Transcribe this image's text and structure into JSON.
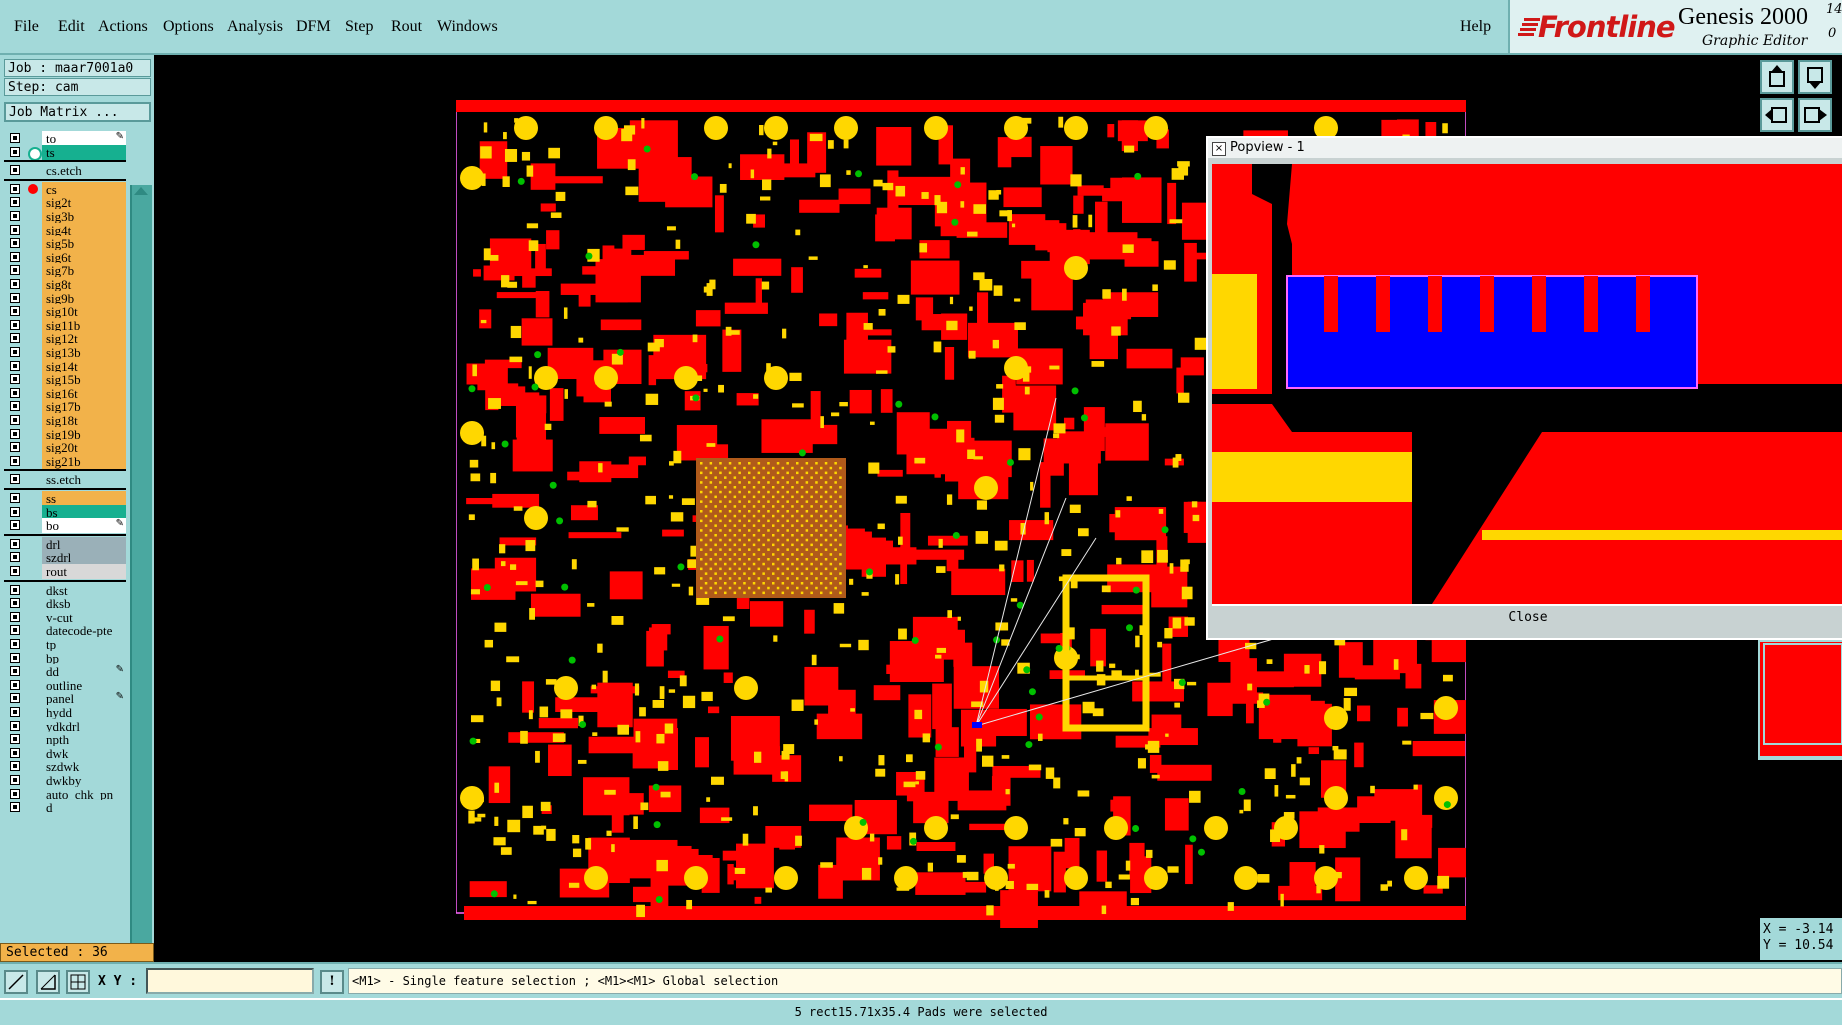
{
  "menu": {
    "items": [
      "File",
      "Edit",
      "Actions",
      "Options",
      "Analysis",
      "DFM",
      "Step",
      "Rout",
      "Windows"
    ],
    "help": "Help"
  },
  "logo": {
    "brand": "Frontline",
    "product": "Genesis 2000",
    "version_top": "14",
    "version_bottom": "0",
    "subtitle": "Graphic Editor"
  },
  "job": {
    "job_label": "Job : maar7001a0",
    "step_label": "Step: cam",
    "matrix_button": "Job Matrix ..."
  },
  "layers": [
    {
      "name": "to",
      "color": "#ffffff",
      "icon": "pencil-icon"
    },
    {
      "name": "ts",
      "color": "#16b090",
      "icon": "marker-icon"
    },
    {
      "name": "cs.etch",
      "color": "#a3d9d9"
    },
    {
      "name": "cs",
      "color": "#f2b24a",
      "active": true
    },
    {
      "name": "sig2t",
      "color": "#f2b24a"
    },
    {
      "name": "sig3b",
      "color": "#f2b24a"
    },
    {
      "name": "sig4t",
      "color": "#f2b24a"
    },
    {
      "name": "sig5b",
      "color": "#f2b24a"
    },
    {
      "name": "sig6t",
      "color": "#f2b24a"
    },
    {
      "name": "sig7b",
      "color": "#f2b24a"
    },
    {
      "name": "sig8t",
      "color": "#f2b24a"
    },
    {
      "name": "sig9b",
      "color": "#f2b24a"
    },
    {
      "name": "sig10t",
      "color": "#f2b24a"
    },
    {
      "name": "sig11b",
      "color": "#f2b24a"
    },
    {
      "name": "sig12t",
      "color": "#f2b24a"
    },
    {
      "name": "sig13b",
      "color": "#f2b24a"
    },
    {
      "name": "sig14t",
      "color": "#f2b24a"
    },
    {
      "name": "sig15b",
      "color": "#f2b24a"
    },
    {
      "name": "sig16t",
      "color": "#f2b24a"
    },
    {
      "name": "sig17b",
      "color": "#f2b24a"
    },
    {
      "name": "sig18t",
      "color": "#f2b24a"
    },
    {
      "name": "sig19b",
      "color": "#f2b24a"
    },
    {
      "name": "sig20t",
      "color": "#f2b24a"
    },
    {
      "name": "sig21b",
      "color": "#f2b24a"
    },
    {
      "name": "ss.etch",
      "color": "#a3d9d9"
    },
    {
      "name": "ss",
      "color": "#f2b24a"
    },
    {
      "name": "bs",
      "color": "#16b090"
    },
    {
      "name": "bo",
      "color": "#ffffff",
      "icon": "pencil-icon"
    },
    {
      "name": "drl",
      "color": "#9ab0b8"
    },
    {
      "name": "szdrl",
      "color": "#9ab0b8"
    },
    {
      "name": "rout",
      "color": "#d8d8d8"
    },
    {
      "name": "dkst",
      "color": "#a3d9d9"
    },
    {
      "name": "dksb",
      "color": "#a3d9d9"
    },
    {
      "name": "v-cut",
      "color": "#a3d9d9"
    },
    {
      "name": "datecode-pte",
      "color": "#a3d9d9"
    },
    {
      "name": "tp",
      "color": "#a3d9d9"
    },
    {
      "name": "bp",
      "color": "#a3d9d9"
    },
    {
      "name": "dd",
      "color": "#a3d9d9",
      "icon": "pencil-icon"
    },
    {
      "name": "outline",
      "color": "#a3d9d9"
    },
    {
      "name": "panel",
      "color": "#a3d9d9",
      "icon": "pencil-icon"
    },
    {
      "name": "hydd",
      "color": "#a3d9d9"
    },
    {
      "name": "ydkdrl",
      "color": "#a3d9d9"
    },
    {
      "name": "npth",
      "color": "#a3d9d9"
    },
    {
      "name": "dwk",
      "color": "#a3d9d9"
    },
    {
      "name": "szdwk",
      "color": "#a3d9d9"
    },
    {
      "name": "dwkby",
      "color": "#a3d9d9"
    },
    {
      "name": "auto_chk_pn",
      "color": "#a3d9d9"
    },
    {
      "name": "d",
      "color": "#a3d9d9"
    }
  ],
  "selection": {
    "selected_label": "Selected : 36"
  },
  "popview": {
    "title": "Popview - 1",
    "close_label": "Close"
  },
  "coords": {
    "x": "X = -3.14",
    "y": "Y = 10.54"
  },
  "bottom": {
    "xy_label": "X Y :",
    "xy_value": "",
    "hint": "<M1> - Single feature selection ; <M1><M1> Global selection",
    "status": "5 rect15.71x35.4 Pads were selected"
  },
  "colors": {
    "panel": "#a3d9d9",
    "copper": "#ff0000",
    "pad": "#ffd700",
    "via": "#00c000",
    "selected": "#0000ff",
    "outline": "#ff66ff"
  }
}
